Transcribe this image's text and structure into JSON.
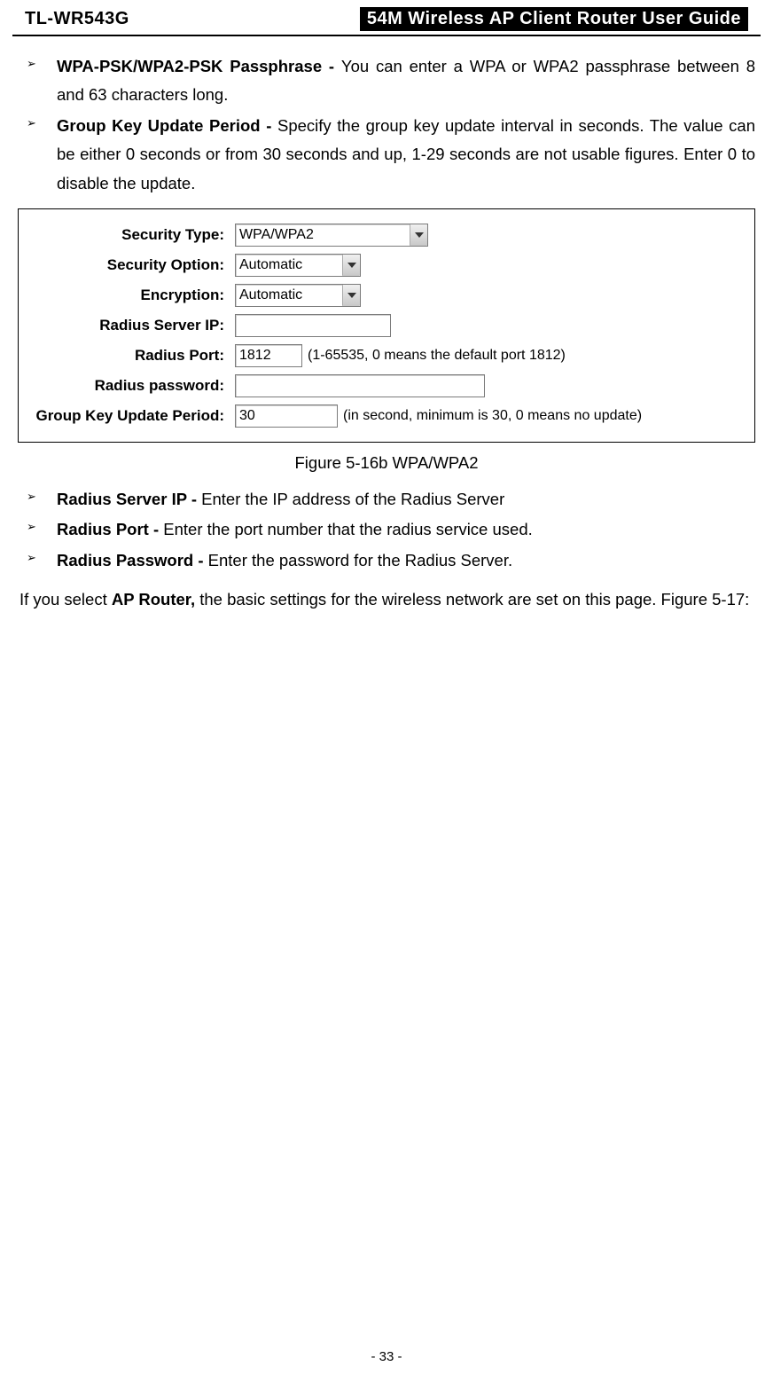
{
  "header": {
    "model": "TL-WR543G",
    "title": "54M Wireless AP Client Router User Guide"
  },
  "bullets_top": [
    {
      "bold": "WPA-PSK/WPA2-PSK Passphrase - ",
      "text": "You can enter a WPA or WPA2 passphrase between 8 and 63 characters long."
    },
    {
      "bold": "Group Key Update Period - ",
      "text": "Specify the group key update interval in seconds. The value can be either 0 seconds or from 30 seconds and up, 1-29 seconds are not usable figures. Enter 0 to disable the update."
    }
  ],
  "figure": {
    "rows": {
      "security_type": {
        "label": "Security Type:",
        "value": "WPA/WPA2"
      },
      "security_option": {
        "label": "Security Option:",
        "value": "Automatic"
      },
      "encryption": {
        "label": "Encryption:",
        "value": "Automatic"
      },
      "radius_server_ip": {
        "label": "Radius Server IP:",
        "value": ""
      },
      "radius_port": {
        "label": "Radius Port:",
        "value": "1812",
        "hint": "(1-65535, 0 means the default port 1812)"
      },
      "radius_password": {
        "label": "Radius password:",
        "value": ""
      },
      "group_key": {
        "label": "Group Key Update Period:",
        "value": "30",
        "hint": "(in second, minimum is 30, 0 means no update)"
      }
    },
    "caption": "Figure 5-16b      WPA/WPA2"
  },
  "bullets_mid": [
    {
      "bold": "Radius Server IP - ",
      "text": "Enter the IP address of the Radius Server"
    },
    {
      "bold": "Radius Port - ",
      "text": "Enter the port number that the radius service used."
    },
    {
      "bold": "Radius Password - ",
      "text": "Enter the password for the Radius Server."
    }
  ],
  "body": {
    "pre": "If you select ",
    "bold": "AP Router,",
    "post": " the basic settings for the wireless network are set on this page. Figure 5-17:"
  },
  "page_number": "- 33 -"
}
